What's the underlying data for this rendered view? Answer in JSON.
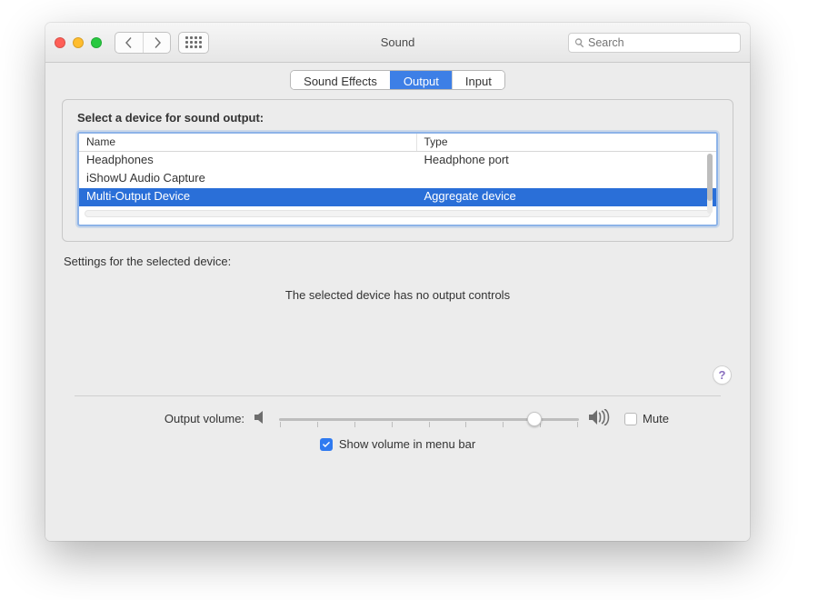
{
  "window": {
    "title": "Sound"
  },
  "toolbar": {
    "search_placeholder": "Search"
  },
  "tabs": {
    "sound_effects": "Sound Effects",
    "output": "Output",
    "input": "Input",
    "active": "output"
  },
  "output_panel": {
    "heading": "Select a device for sound output:",
    "columns": {
      "name": "Name",
      "type": "Type"
    },
    "devices": [
      {
        "name": "Headphones",
        "type": "Headphone port",
        "selected": false
      },
      {
        "name": "iShowU Audio Capture",
        "type": "",
        "selected": false
      },
      {
        "name": "Multi-Output Device",
        "type": "Aggregate device",
        "selected": true
      }
    ]
  },
  "settings": {
    "label": "Settings for the selected device:",
    "message": "The selected device has no output controls"
  },
  "help": {
    "symbol": "?"
  },
  "volume": {
    "label": "Output volume:",
    "value_percent": 85,
    "mute_label": "Mute",
    "mute_checked": false,
    "show_in_menubar_label": "Show volume in menu bar",
    "show_in_menubar_checked": true
  }
}
